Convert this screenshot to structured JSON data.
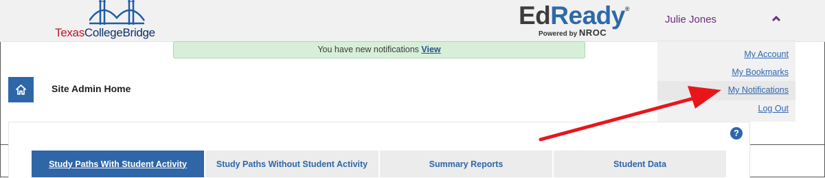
{
  "header": {
    "logo_left": {
      "part1": "Texas",
      "part2": "CollegeBridge"
    },
    "logo_right": {
      "word1": "Ed",
      "word2": "Ready",
      "reg": "®",
      "powered_by": "Powered by",
      "brand": "NROC"
    }
  },
  "user": {
    "name": "Julie Jones",
    "menu": [
      {
        "label": "My Account"
      },
      {
        "label": "My Bookmarks"
      },
      {
        "label": "My Notifications"
      },
      {
        "label": "Log Out"
      }
    ]
  },
  "notification": {
    "message": "You have new notifications",
    "link": "View"
  },
  "page": {
    "title": "Site Admin Home",
    "help": "?"
  },
  "tabs": [
    {
      "label": "Study Paths With Student Activity",
      "active": true
    },
    {
      "label": "Study Paths Without Student Activity",
      "active": false
    },
    {
      "label": "Summary Reports",
      "active": false
    },
    {
      "label": "Student Data",
      "active": false
    }
  ],
  "colors": {
    "accent": "#2e66a8",
    "user_name": "#6b2e7b",
    "notification_bg": "#d7efd9",
    "annotation_arrow": "#e8161b"
  }
}
